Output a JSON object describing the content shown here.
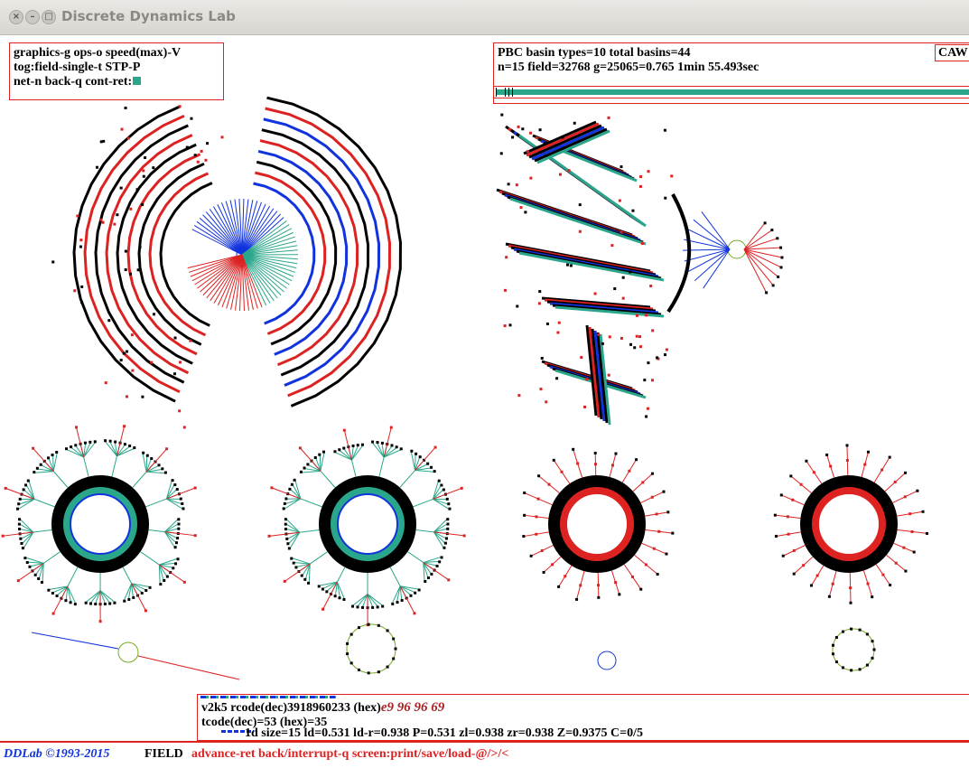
{
  "window": {
    "title": "Discrete Dynamics Lab",
    "close_glyph": "×",
    "min_glyph": "–",
    "max_glyph": "□"
  },
  "menu": {
    "line1": "graphics-g ops-o speed(max)-V",
    "line2": "tog:field-single-t STP-P",
    "line3": "net-n back-q cont-ret:"
  },
  "info": {
    "line1": "PBC basin types=10 total basins=44",
    "line2": "n=15 field=32768 g=25065=0.765  1min 55.493sec",
    "progress": 1.0,
    "corner": "CAW"
  },
  "rule": {
    "line1": "v2k5 rcode(dec)3918960233  (hex)",
    "hex": "e9 96 96 69",
    "line2": "tcode(dec)=53 (hex)=35",
    "line3": "1d size=15 ld=0.531 ld-r=0.938 P=0.531 zl=0.938 zr=0.938 Z=0.9375 C=0/5"
  },
  "status": {
    "copyright": "DDLab ©1993-2015",
    "mode": "FIELD",
    "hint": "advance-ret back/interrupt-q   screen:print/save/load-@/>/<"
  },
  "colors": {
    "red": "#dd2222",
    "green": "#2aa68a",
    "blue": "#1133dd",
    "black": "#000000",
    "olive": "#77aa22"
  }
}
